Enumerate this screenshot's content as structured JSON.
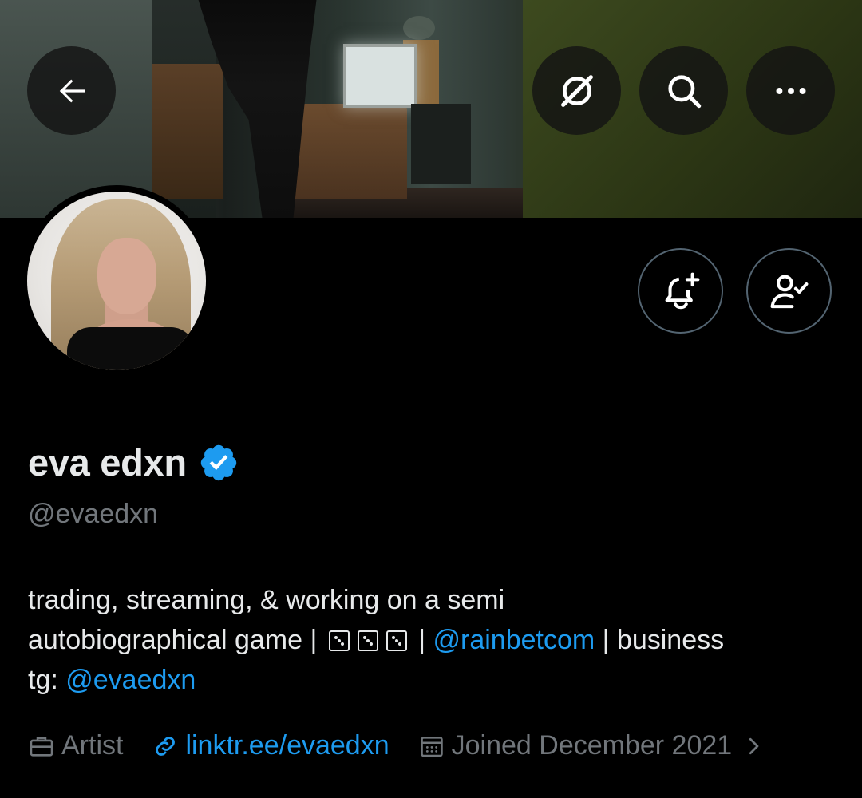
{
  "header": {
    "back_icon": "arrow-left-icon",
    "grok_icon": "grok-icon",
    "search_icon": "search-icon",
    "more_icon": "more-horizontal-icon"
  },
  "profile": {
    "display_name": "eva edxn",
    "verified": true,
    "verified_color": "#1d9bf0",
    "handle": "@evaedxn",
    "bio": {
      "line1_text": "trading, streaming, & working on a semi",
      "line2_prefix": "autobiographical game | ",
      "line2_sep": " | ",
      "mention1": "@rainbetcom",
      "line2_suffix": " | business",
      "line3_prefix": "tg: ",
      "mention2": "@evaedxn"
    },
    "category": "Artist",
    "website": "linktr.ee/evaedxn",
    "joined": "Joined December 2021"
  },
  "actions": {
    "notify_icon": "bell-plus-icon",
    "following_icon": "person-check-icon"
  },
  "colors": {
    "background": "#000000",
    "text_primary": "#e7e9ea",
    "text_secondary": "#71767b",
    "link": "#1d9bf0",
    "border": "#536471"
  }
}
